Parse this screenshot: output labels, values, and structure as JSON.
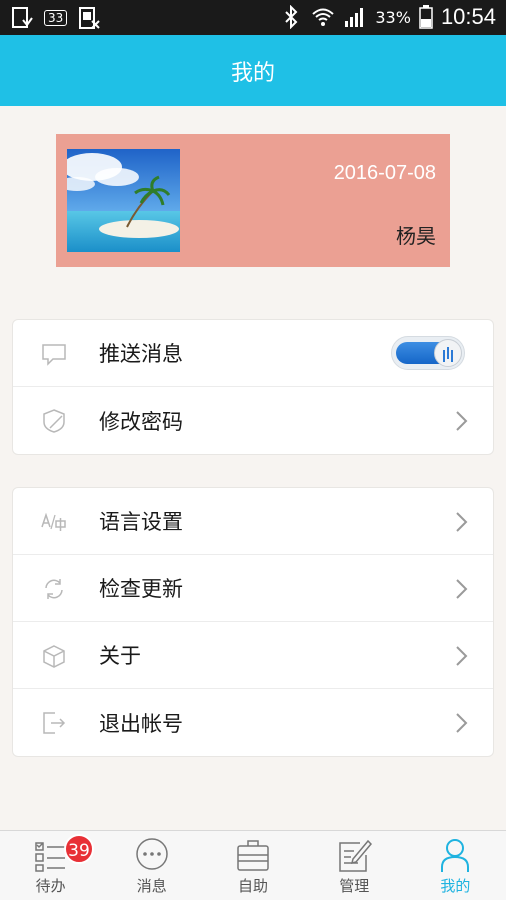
{
  "status_bar": {
    "icons_left": [
      "download-notification-icon",
      "sim-33-icon",
      "sim-off-icon"
    ],
    "sim_label": "33",
    "battery": "33%",
    "time": "10:54"
  },
  "header": {
    "title": "我的"
  },
  "profile": {
    "date": "2016-07-08",
    "name": "杨昊"
  },
  "group1": [
    {
      "label": "推送消息",
      "icon": "chat-bubble-icon",
      "control": "toggle",
      "on": true
    },
    {
      "label": "修改密码",
      "icon": "shield-icon",
      "control": "chevron"
    }
  ],
  "group2": [
    {
      "label": "语言设置",
      "icon": "translate-icon",
      "control": "chevron"
    },
    {
      "label": "检查更新",
      "icon": "refresh-icon",
      "control": "chevron"
    },
    {
      "label": "关于",
      "icon": "cube-icon",
      "control": "chevron"
    },
    {
      "label": "退出帐号",
      "icon": "logout-icon",
      "control": "chevron"
    }
  ],
  "tabs": [
    {
      "label": "待办",
      "icon": "todo-list-icon",
      "badge": "39"
    },
    {
      "label": "消息",
      "icon": "message-icon"
    },
    {
      "label": "自助",
      "icon": "briefcase-icon"
    },
    {
      "label": "管理",
      "icon": "edit-note-icon"
    },
    {
      "label": "我的",
      "icon": "person-icon",
      "active": true
    }
  ],
  "colors": {
    "accent": "#1fc0e6",
    "profile_bg": "#eba093",
    "badge": "#e83036",
    "active_tab": "#1fb3e0"
  }
}
